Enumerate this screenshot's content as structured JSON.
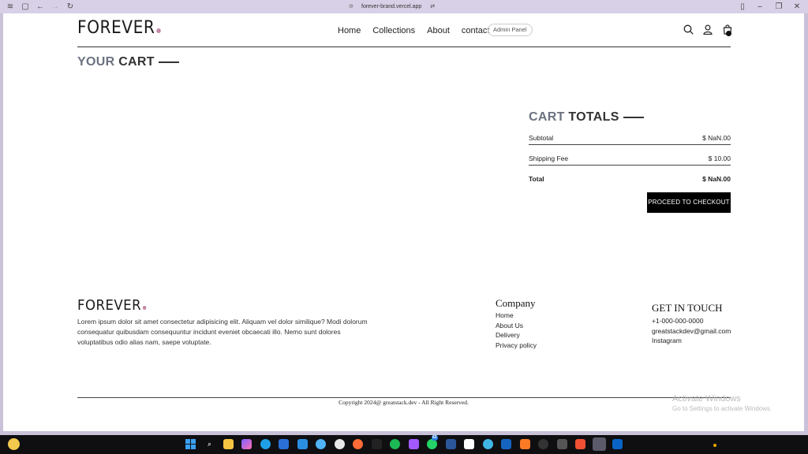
{
  "browser": {
    "url": "forever-brand.vercel.app",
    "icons": [
      "sidebar-icon",
      "tabs-icon",
      "back-icon",
      "forward-icon",
      "refresh-icon",
      "link-icon",
      "site-settings-icon",
      "split-view-icon",
      "minimize-icon",
      "maximize-icon",
      "close-icon"
    ]
  },
  "navbar": {
    "logo": "FOREVER",
    "links": [
      "Home",
      "Collections",
      "About",
      "contact"
    ],
    "admin": "Admin Panel",
    "icons": [
      "search-icon",
      "profile-icon",
      "cart-icon"
    ]
  },
  "cart": {
    "title_a": "YOUR",
    "title_b": "CART"
  },
  "totals": {
    "title_a": "CART",
    "title_b": "TOTALS",
    "subtotal_label": "Subtotal",
    "subtotal_value": "$ NaN.00",
    "shipping_label": "Shipping Fee",
    "shipping_value": "$ 10.00",
    "total_label": "Total",
    "total_value": "$ NaN.00",
    "checkout": "PROCEED TO CHECKOUT"
  },
  "footer": {
    "logo": "FOREVER",
    "description": "Lorem ipsum dolor sit amet consectetur adipisicing elit. Aliquam vel dolor similique? Modi dolorum consequatur quibusdam consequuntur incidunt eveniet obcaecati illo. Nemo sunt dolores voluptatibus odio alias nam, saepe voluptate.",
    "company_heading": "Company",
    "company_links": [
      "Home",
      "About Us",
      "Delivery",
      "Privacy policy"
    ],
    "touch_heading": "GET IN TOUCH",
    "touch_items": [
      "+1-000-000-0000",
      "greatstackdev@gmail.com",
      "Instagram"
    ],
    "copyright": "Copyright 2024@ greatstack.dev - All Right Reserved."
  },
  "watermark": {
    "line1": "Activate Windows",
    "line2": "Go to Settings to activate Windows."
  },
  "taskbar": {
    "icons": [
      "weather-icon",
      "start-icon",
      "search-icon",
      "file-explorer-icon",
      "copilot-icon",
      "edge-icon",
      "store-icon",
      "vscode-icon",
      "recycle-icon",
      "chrome-icon",
      "postman-icon",
      "terminal-icon",
      "spotify-icon",
      "figma-icon",
      "whatsapp-icon",
      "word-icon",
      "notion-icon",
      "edge-dev-icon",
      "l-app-icon",
      "xampp-icon",
      "github-icon",
      "calculator-icon",
      "git-icon",
      "browser-active-icon",
      "outlook-icon",
      "tray-indicator-icon"
    ],
    "whatsapp_badge": "62"
  }
}
